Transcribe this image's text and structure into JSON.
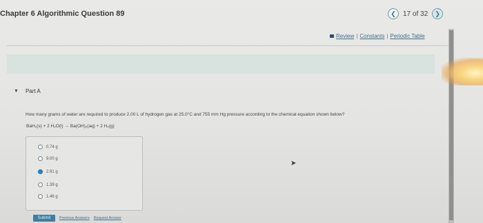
{
  "header": {
    "title": "Chapter 6 Algorithmic Question 89",
    "counter": "17 of 32",
    "prev_icon": "chevron-left-icon",
    "next_icon": "chevron-right-icon"
  },
  "links": {
    "review": "Review",
    "constants": "Constants",
    "periodic_table": "Periodic Table",
    "separator": "|"
  },
  "part": {
    "label": "Part A"
  },
  "question": {
    "text": "How many grams of water are required to produce 2.00 L of hydrogen gas at 25.0°C and 755 mm Hg pressure according to the chemical equation shown below?",
    "equation": "BaH₂(s) + 2 H₂O(l) → Ba(OH)₂(aq) + 2 H₂(g)"
  },
  "options": [
    {
      "label": "0.74 g",
      "selected": false
    },
    {
      "label": "9.00 g",
      "selected": false
    },
    {
      "label": "2.91 g",
      "selected": true
    },
    {
      "label": "1.39 g",
      "selected": false
    },
    {
      "label": "1.46 g",
      "selected": false
    }
  ],
  "actions": {
    "submit": "Submit",
    "previous_answers": "Previous Answers",
    "request_answer": "Request Answer"
  },
  "colors": {
    "accent": "#3c7fa0",
    "link": "#3f6f86",
    "selected_radio": "#2f7db4"
  }
}
